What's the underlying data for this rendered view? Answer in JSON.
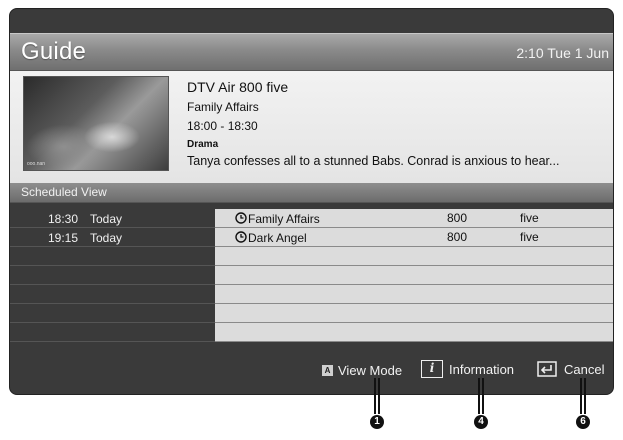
{
  "header": {
    "title": "Guide",
    "clock": "2:10 Tue 1 Jun"
  },
  "info": {
    "thumbnail_badge": "ooo.nan",
    "channel": "DTV Air 800 five",
    "programme": "Family Affairs",
    "time": "18:00 - 18:30",
    "genre": "Drama",
    "synopsis": "Tanya confesses all to a stunned Babs. Conrad is anxious to hear..."
  },
  "schedule": {
    "header": "Scheduled View",
    "rows": [
      {
        "time": "18:30",
        "day": "Today",
        "programme": "Family Affairs",
        "number": "800",
        "channel": "five"
      },
      {
        "time": "19:15",
        "day": "Today",
        "programme": "Dark Angel",
        "number": "800",
        "channel": "five"
      }
    ]
  },
  "footer": {
    "a_key": "A",
    "view_mode": "View Mode",
    "info_key": "i",
    "information": "Information",
    "cancel": "Cancel"
  },
  "callouts": [
    "1",
    "4",
    "6"
  ]
}
